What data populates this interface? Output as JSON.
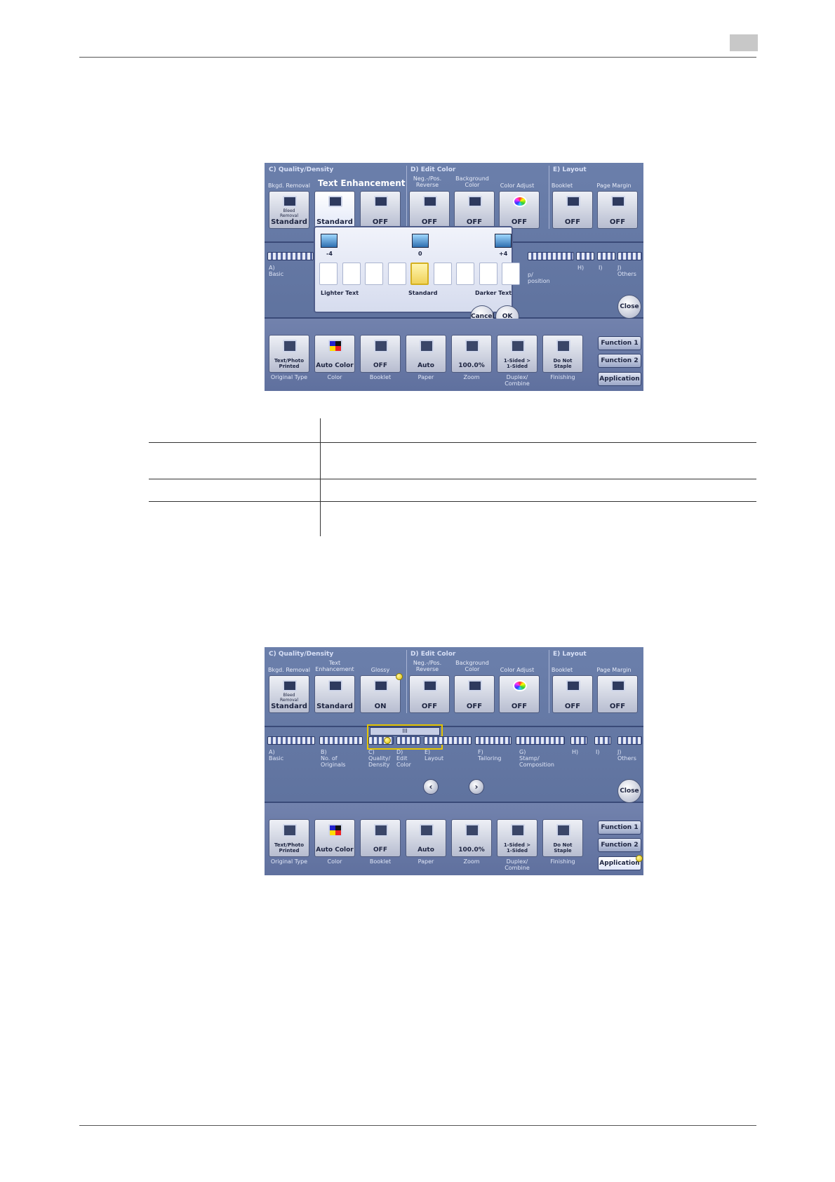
{
  "screen1": {
    "groups": {
      "c": "C)  Quality/Density",
      "d": "D)  Edit Color",
      "e": "E)  Layout"
    },
    "headers": {
      "bkgd_removal": "Bkgd. Removal",
      "text_enhancement": "Text Enhancement",
      "neg_pos_reverse": "Neg.-/Pos.\nReverse",
      "background_color": "Background\nColor",
      "color_adjust": "Color Adjust",
      "booklet": "Booklet",
      "page_margin": "Page Margin"
    },
    "tiles": {
      "bkgd_removal_sub": "Bleed\nRemoval",
      "bkgd_removal_value": "Standard",
      "text_enhancement_value": "Standard",
      "glossy_value": "OFF",
      "neg_pos_value": "OFF",
      "background_color_value": "OFF",
      "color_adjust_value": "OFF",
      "booklet_value": "OFF",
      "page_margin_value": "OFF"
    },
    "tabs": {
      "a": "A)\nBasic",
      "g_partial": "p/\nposition",
      "h": "H)",
      "i": "I)",
      "j": "J)\nOthers"
    },
    "popup": {
      "title": "Text Enhancement",
      "min": "-4",
      "mid": "0",
      "max": "+4",
      "lighter": "Lighter Text",
      "standard": "Standard",
      "darker": "Darker Text",
      "level": 0,
      "cancel": "Cancel",
      "ok": "OK"
    },
    "close": "Close"
  },
  "screen2": {
    "groups": {
      "c": "C)  Quality/Density",
      "d": "D)  Edit Color",
      "e": "E)  Layout"
    },
    "headers": {
      "bkgd_removal": "Bkgd. Removal",
      "text_enhancement": "Text\nEnhancement",
      "glossy": "Glossy",
      "neg_pos_reverse": "Neg.-/Pos.\nReverse",
      "background_color": "Background\nColor",
      "color_adjust": "Color Adjust",
      "booklet": "Booklet",
      "page_margin": "Page Margin"
    },
    "tiles": {
      "bkgd_removal_sub": "Bleed\nRemoval",
      "bkgd_removal_value": "Standard",
      "text_enhancement_value": "Standard",
      "glossy_value": "ON",
      "neg_pos_value": "OFF",
      "background_color_value": "OFF",
      "color_adjust_value": "OFF",
      "booklet_value": "OFF",
      "page_margin_value": "OFF"
    },
    "scroll_thumb": "III",
    "tabs": {
      "a": "A)\nBasic",
      "b": "B)\nNo. of\nOriginals",
      "c": "C)\nQuality/\nDensity",
      "d": "D)\nEdit\nColor",
      "e": "E)\nLayout",
      "f": "F)\nTailoring",
      "g": "G)\nStamp/\nComposition",
      "h": "H)",
      "i": "I)",
      "j": "J)\nOthers"
    },
    "nav_prev": "‹",
    "nav_next": "›",
    "close": "Close"
  },
  "bottom": {
    "tiles": [
      {
        "value": "Text/Photo\nPrinted",
        "label": "Original Type",
        "icon": "original-type-icon"
      },
      {
        "value": "Auto Color",
        "label": "Color",
        "icon": "color-icon"
      },
      {
        "value": "OFF",
        "label": "Booklet",
        "icon": "booklet-icon"
      },
      {
        "value": "Auto",
        "label": "Paper",
        "icon": "paper-icon"
      },
      {
        "value": "100.0%",
        "label": "Zoom",
        "icon": "zoom-icon"
      },
      {
        "value": "1-Sided >\n1-Sided",
        "label": "Duplex/\nCombine",
        "icon": "duplex-icon"
      },
      {
        "value": "Do Not\nStaple",
        "label": "Finishing",
        "icon": "finishing-icon"
      }
    ],
    "function1": "Function 1",
    "function2": "Function 2",
    "application": "Application"
  }
}
